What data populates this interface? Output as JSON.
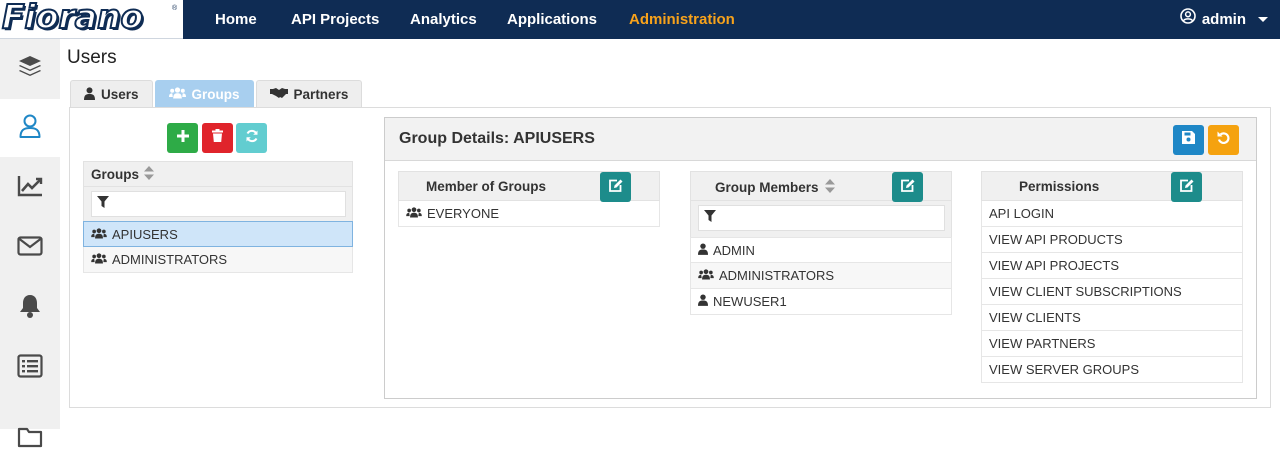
{
  "app": {
    "logo_text": "Fiorano",
    "logo_tm": "®"
  },
  "nav": {
    "items": [
      {
        "label": "Home"
      },
      {
        "label": "API Projects"
      },
      {
        "label": "Analytics"
      },
      {
        "label": "Applications"
      },
      {
        "label": "Administration",
        "active": true
      }
    ],
    "user": "admin"
  },
  "colors": {
    "nav_bg": "#0f2c54",
    "nav_active": "#f7a21b",
    "tab_active": "#a8cfef",
    "selected_row": "#cfe5f9"
  },
  "rail": {
    "icons": [
      "layers-icon",
      "user-icon",
      "chart-icon",
      "mail-icon",
      "bell-icon",
      "list-icon",
      "folder-icon"
    ],
    "active": "user-icon"
  },
  "page": {
    "title": "Users"
  },
  "tabs": [
    {
      "label": "Users",
      "icon": "user-icon"
    },
    {
      "label": "Groups",
      "icon": "users-icon",
      "active": true
    },
    {
      "label": "Partners",
      "icon": "handshake-icon"
    }
  ],
  "groups_panel": {
    "header": "Groups",
    "filter_placeholder": "",
    "rows": [
      {
        "label": "APIUSERS",
        "selected": true
      },
      {
        "label": "ADMINISTRATORS",
        "selected": false
      }
    ]
  },
  "details": {
    "title": "Group Details: APIUSERS",
    "member_of": {
      "header": "Member of Groups",
      "rows": [
        "EVERYONE"
      ]
    },
    "members": {
      "header": "Group Members",
      "rows": [
        {
          "label": "ADMIN",
          "type": "user"
        },
        {
          "label": "ADMINISTRATORS",
          "type": "group"
        },
        {
          "label": "NEWUSER1",
          "type": "user"
        }
      ]
    },
    "permissions": {
      "header": "Permissions",
      "rows": [
        "API LOGIN",
        "VIEW API PRODUCTS",
        "VIEW API PROJECTS",
        "VIEW CLIENT SUBSCRIPTIONS",
        "VIEW CLIENTS",
        "VIEW PARTNERS",
        "VIEW SERVER GROUPS"
      ]
    }
  }
}
